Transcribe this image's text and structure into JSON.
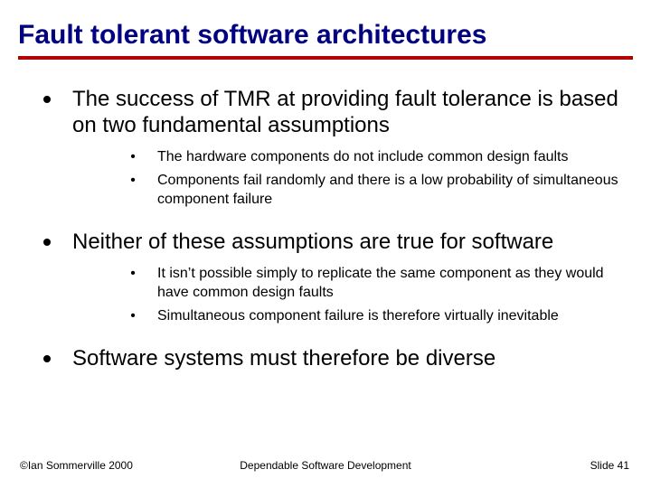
{
  "title": "Fault tolerant software architectures",
  "bullets": [
    {
      "text": "The success of TMR at providing fault tolerance is based on two fundamental assumptions",
      "sub": [
        "The hardware components do not include common design faults",
        "Components fail randomly and there is a low probability of simultaneous component failure"
      ]
    },
    {
      "text": "Neither of these assumptions are true for software",
      "sub": [
        "It isn’t possible simply to replicate the same component as they would have common design faults",
        "Simultaneous component failure is therefore virtually inevitable"
      ]
    },
    {
      "text": "Software systems must therefore be diverse",
      "sub": []
    }
  ],
  "footer": {
    "left": "©Ian Sommerville 2000",
    "center": "Dependable Software Development",
    "right": "Slide 41"
  }
}
